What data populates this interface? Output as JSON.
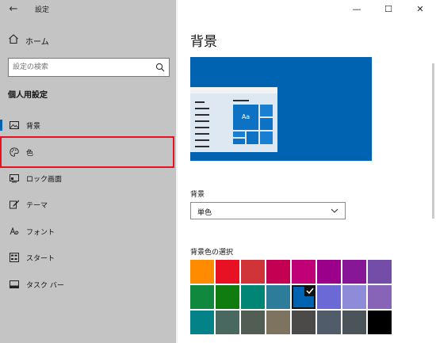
{
  "window": {
    "title": "設定",
    "back_label": "←",
    "minimize": "—",
    "maximize": "☐",
    "close": "✕"
  },
  "sidebar": {
    "home_label": "ホーム",
    "search_placeholder": "設定の検索",
    "section_title": "個人用設定",
    "items": [
      {
        "label": "背景",
        "icon": "picture-icon",
        "selected": true
      },
      {
        "label": "色",
        "icon": "palette-icon",
        "selected": false
      },
      {
        "label": "ロック画面",
        "icon": "lock-screen-icon",
        "selected": false
      },
      {
        "label": "テーマ",
        "icon": "theme-brush-icon",
        "selected": false
      },
      {
        "label": "フォント",
        "icon": "font-icon",
        "selected": false
      },
      {
        "label": "スタート",
        "icon": "start-grid-icon",
        "selected": false
      },
      {
        "label": "タスク バー",
        "icon": "taskbar-icon",
        "selected": false
      }
    ]
  },
  "main": {
    "title": "背景",
    "preview_tile_text": "Aa",
    "background_label": "背景",
    "background_value": "単色",
    "color_select_label": "背景色の選択",
    "swatches": [
      [
        "#ff8c00",
        "#e81123",
        "#d13438",
        "#c30052",
        "#bf0077",
        "#9a0089",
        "#881798",
        "#744da9"
      ],
      [
        "#10893e",
        "#107c10",
        "#018574",
        "#2d7d9a",
        "#0063b1",
        "#6b69d6",
        "#8e8cd8",
        "#8764b8"
      ],
      [
        "#038387",
        "#486860",
        "#525e54",
        "#7e735f",
        "#4c4a48",
        "#515c6b",
        "#4a5459",
        "#000000"
      ]
    ],
    "selected_swatch": [
      1,
      4
    ]
  },
  "colors": {
    "accent": "#0063b1",
    "highlight": "#e81123",
    "sidebar_bg": "#c4c4c4"
  }
}
